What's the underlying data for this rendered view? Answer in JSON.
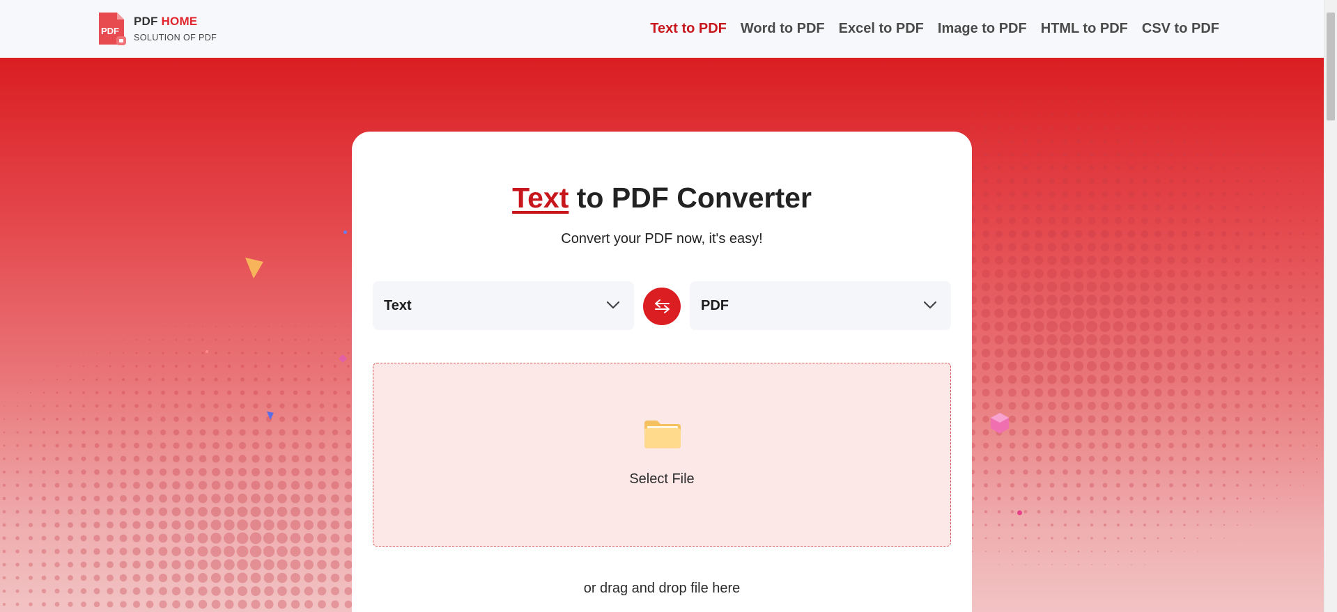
{
  "logo": {
    "brand_left": "PDF",
    "brand_right": "HOME",
    "tagline": "SOLUTION OF PDF",
    "icon_text": "PDF"
  },
  "nav": [
    {
      "label": "Text to PDF",
      "active": true
    },
    {
      "label": "Word to PDF"
    },
    {
      "label": "Excel to PDF"
    },
    {
      "label": "Image to PDF"
    },
    {
      "label": "HTML to PDF"
    },
    {
      "label": "CSV to PDF"
    }
  ],
  "converter": {
    "title_highlight": "Text",
    "title_rest": " to PDF Converter",
    "subtitle": "Convert your PDF now, it's easy!",
    "from": "Text",
    "to": "PDF",
    "select_file": "Select File",
    "drag_drop": "or drag and drop file here"
  },
  "colors": {
    "accent": "#db1e22",
    "active_nav": "#c8161d"
  }
}
